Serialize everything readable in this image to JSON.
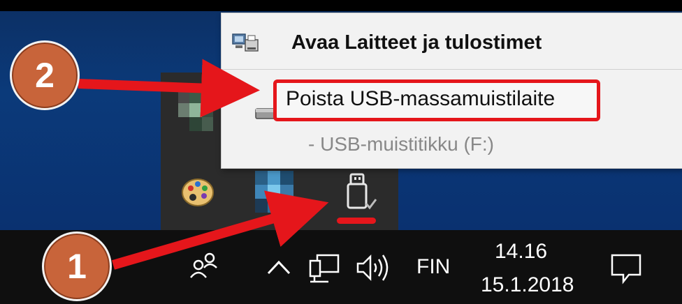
{
  "context_menu": {
    "open_devices_label": "Avaa Laitteet ja tulostimet",
    "eject_label": "Poista USB-massamuistilaite",
    "device_entry": "-  USB-muistitikku (F:)"
  },
  "taskbar": {
    "language": "FIN",
    "time": "14.16",
    "date": "15.1.2018"
  },
  "annotations": {
    "step_1": "1",
    "step_2": "2"
  },
  "colors": {
    "annotation_red": "#e5161b",
    "badge_orange": "#c8643a"
  }
}
